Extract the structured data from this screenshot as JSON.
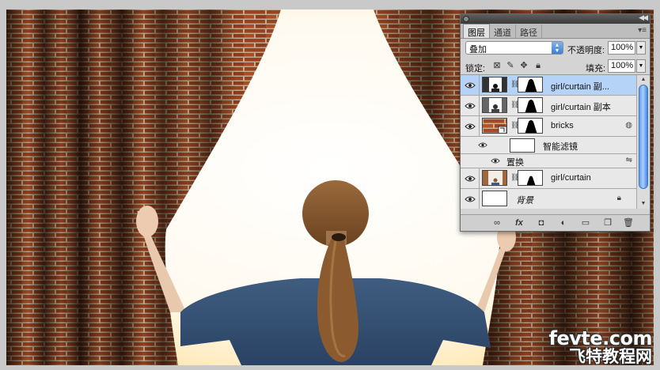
{
  "watermark": {
    "line1": "fevte.com",
    "line2": "飞特教程网"
  },
  "layers_panel": {
    "tabs": [
      {
        "label": "图层",
        "active": true
      },
      {
        "label": "通道",
        "active": false
      },
      {
        "label": "路径",
        "active": false
      }
    ],
    "blend_mode": "叠加",
    "opacity_label": "不透明度:",
    "opacity_value": "100%",
    "lock_label": "锁定:",
    "fill_label": "填充:",
    "fill_value": "100%",
    "layers": [
      {
        "name": "girl/curtain 副...",
        "selected": true,
        "visible": true,
        "icon": "layer-mask"
      },
      {
        "name": "girl/curtain 副本",
        "selected": false,
        "visible": true,
        "icon": "layer-mask"
      },
      {
        "name": "bricks",
        "selected": false,
        "visible": true,
        "icon": "smart-object"
      },
      {
        "name": "智能滤镜",
        "selected": false,
        "visible": true,
        "icon": "smart-filter"
      },
      {
        "name": "置换",
        "selected": false,
        "visible": true,
        "icon": "filter-effect"
      },
      {
        "name": "girl/curtain",
        "selected": false,
        "visible": true,
        "icon": "layer-mask"
      },
      {
        "name": "背景",
        "selected": false,
        "visible": true,
        "icon": "background-locked"
      }
    ],
    "colors": {
      "selected_row": "#b4d3f7",
      "scroll_thumb": "#5e9ef0"
    }
  }
}
